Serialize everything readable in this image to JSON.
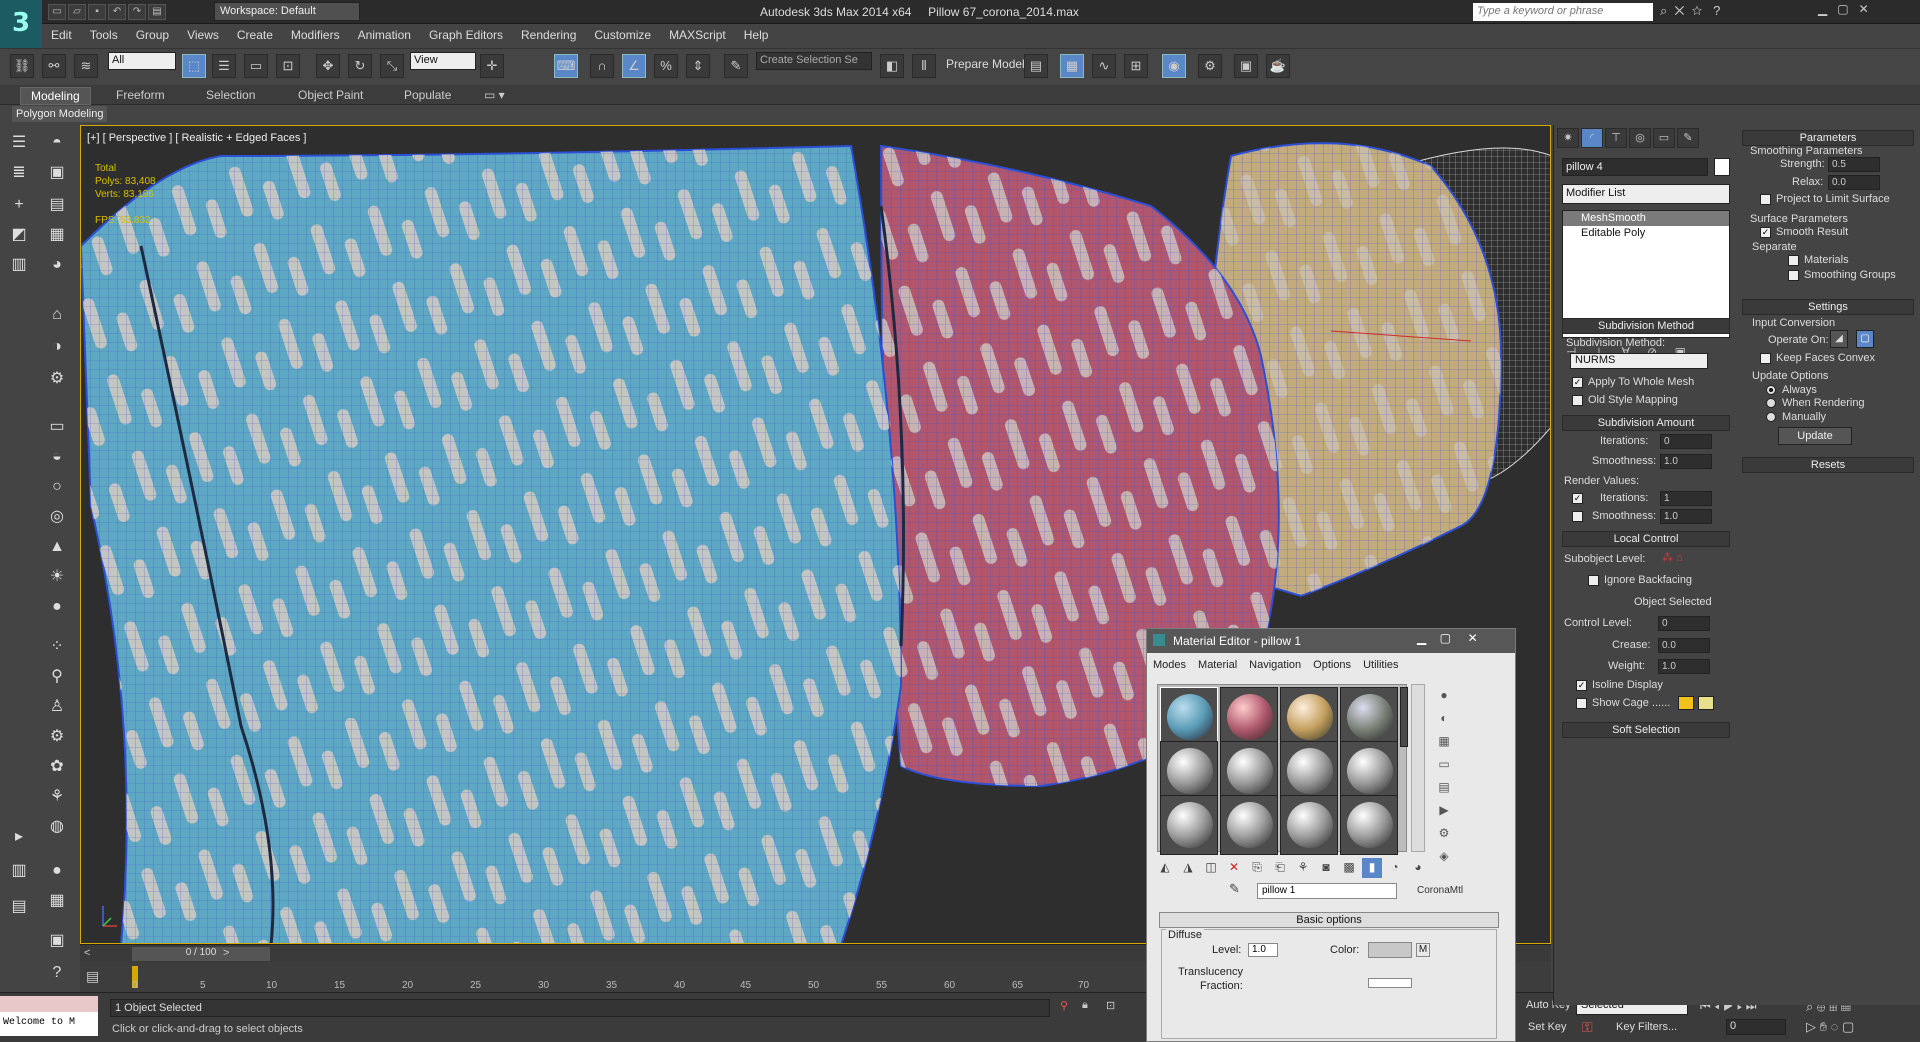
{
  "app": {
    "logo": "3",
    "workspace": "Workspace: Default",
    "product": "Autodesk 3ds Max  2014 x64",
    "file": "Pillow 67_corona_2014.max",
    "search_placeholder": "Type a keyword or phrase"
  },
  "menu": [
    "Edit",
    "Tools",
    "Group",
    "Views",
    "Create",
    "Modifiers",
    "Animation",
    "Graph Editors",
    "Rendering",
    "Customize",
    "MAXScript",
    "Help"
  ],
  "toolbar": {
    "filter": "All",
    "refcoord": "View",
    "selset": "Create Selection Se",
    "prepare": "Prepare Model"
  },
  "ribbon": {
    "tabs": [
      "Modeling",
      "Freeform",
      "Selection",
      "Object Paint",
      "Populate"
    ],
    "active": "Modeling",
    "panel": "Polygon Modeling"
  },
  "viewport": {
    "label": "[+] [ Perspective ] [ Realistic + Edged Faces ]",
    "stats": {
      "total": "Total",
      "polys": "Polys:  83,408",
      "verts": "Verts:  83,196",
      "fps": "FPS:    53.832"
    }
  },
  "timeline": {
    "slider": "0 / 100",
    "ticks": [
      "0",
      "5",
      "10",
      "15",
      "20",
      "25",
      "30",
      "35",
      "40",
      "45",
      "50",
      "55",
      "60",
      "65",
      "70"
    ]
  },
  "status": {
    "listener": "Welcome to M",
    "selected": "1 Object Selected",
    "prompt": "Click or click-and-drag to select objects",
    "autokey": "Auto Key",
    "setkey": "Set Key",
    "mode": "Selected",
    "keyfilters": "Key Filters...",
    "frame": "0"
  },
  "command": {
    "object_name": "pillow 4",
    "modifier_list": "Modifier List",
    "stack": [
      "MeshSmooth",
      "Editable Poly"
    ],
    "subdiv": {
      "title": "Subdivision Method",
      "label": "Subdivision Method:",
      "method": "NURMS",
      "apply": "Apply To Whole Mesh",
      "oldstyle": "Old Style Mapping"
    },
    "amount": {
      "title": "Subdivision Amount",
      "iter_label": "Iterations:",
      "iter": "0",
      "smooth_label": "Smoothness:",
      "smooth": "1.0",
      "render": "Render Values:",
      "r_iter_label": "Iterations:",
      "r_iter": "1",
      "r_smooth_label": "Smoothness:",
      "r_smooth": "1.0"
    },
    "local": {
      "title": "Local Control",
      "sublevel": "Subobject Level:",
      "ignore": "Ignore Backfacing",
      "objsel": "Object Selected",
      "control": "Control Level:",
      "control_val": "0",
      "crease": "Crease:",
      "crease_val": "0.0",
      "weight": "Weight:",
      "weight_val": "1.0",
      "isoline": "Isoline Display",
      "showcage": "Show Cage ......"
    },
    "softsel": "Soft Selection",
    "params": {
      "title": "Parameters",
      "smoothing": "Smoothing Parameters",
      "strength_label": "Strength:",
      "strength": "0.5",
      "relax_label": "Relax:",
      "relax": "0.0",
      "project": "Project to Limit Surface",
      "surface": "Surface Parameters",
      "smoothres": "Smooth Result",
      "separate": "Separate",
      "materials": "Materials",
      "smgroups": "Smoothing Groups"
    },
    "settings": {
      "title": "Settings",
      "input": "Input Conversion",
      "operate": "Operate On:",
      "keepconvex": "Keep Faces Convex",
      "update_opts": "Update Options",
      "always": "Always",
      "whenrender": "When Rendering",
      "manually": "Manually",
      "update": "Update"
    },
    "resets": "Resets"
  },
  "material_editor": {
    "title": "Material Editor - pillow 1",
    "menu": [
      "Modes",
      "Material",
      "Navigation",
      "Options",
      "Utilities"
    ],
    "name": "pillow 1",
    "type": "CoronaMtl",
    "rollout": "Basic options",
    "diffuse": "Diffuse",
    "level_label": "Level:",
    "level": "1.0",
    "color_label": "Color:",
    "m": "M",
    "translucency": "Translucency",
    "fraction": "Fraction:"
  },
  "colors": {
    "accent": "#5a87c7",
    "viewport_border": "#d4a900",
    "cage1": "#f2c21c",
    "cage2": "#e8e08a"
  }
}
